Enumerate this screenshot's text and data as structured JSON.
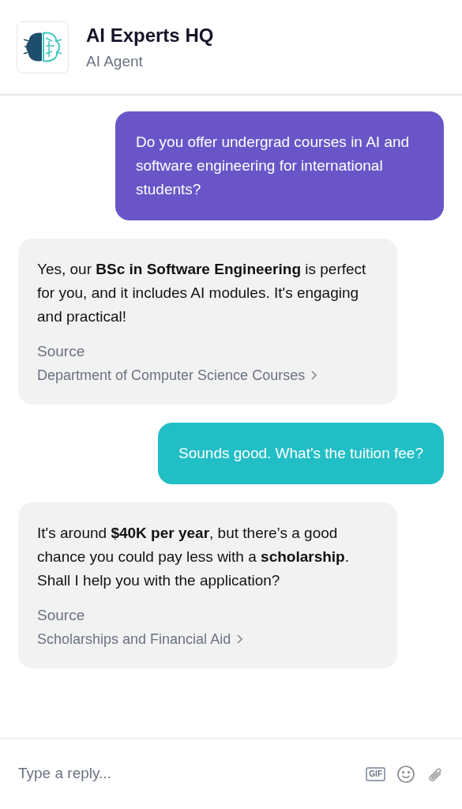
{
  "header": {
    "title": "AI Experts HQ",
    "subtitle": "AI Agent"
  },
  "messages": [
    {
      "kind": "user",
      "color": "#6a55c8",
      "text": "Do you offer undergrad courses in AI and software engineering for international students?"
    },
    {
      "kind": "agent",
      "text": "Yes, our **BSc in Software Engineering** is perfect for you, and it includes AI modules. It's engaging and practical!",
      "source_label": "Source",
      "source_link": "Department of Computer Science Courses"
    },
    {
      "kind": "user",
      "color": "#22bec6",
      "text": "Sounds good. What's the tuition fee?"
    },
    {
      "kind": "agent",
      "text": "It's around **$40K per year**, but there’s a good chance you could pay less with a **scholarship**. Shall I help you with the application?",
      "source_label": "Source",
      "source_link": "Scholarships and Financial Aid"
    }
  ],
  "composer": {
    "placeholder": "Type a reply...",
    "gif_label": "GIF"
  }
}
